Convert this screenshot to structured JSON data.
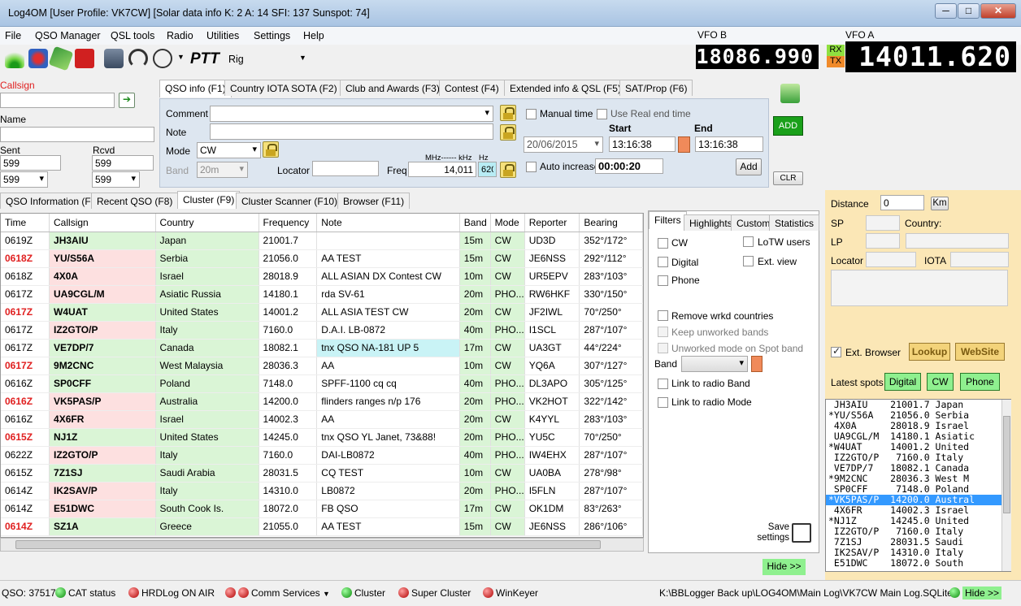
{
  "window": {
    "title": "Log4OM [User Profile: VK7CW] [Solar data info K: 2 A: 14 SFI: 137 Sunspot: 74]"
  },
  "menu": [
    "File",
    "QSO Manager",
    "QSL tools",
    "Radio",
    "Utilities",
    "Settings",
    "Help"
  ],
  "toolbar": {
    "ptt": "PTT",
    "rig_label": "Rig"
  },
  "vfo": {
    "b_label": "VFO B",
    "b_value": "18086.990",
    "a_label": "VFO A",
    "a_value": "14011.620",
    "rx": "RX",
    "tx": "TX"
  },
  "entry": {
    "callsign_label": "Callsign",
    "callsign_value": "",
    "name_label": "Name",
    "name_value": "",
    "sent_label": "Sent",
    "sent_value": "599",
    "sent_select": "599",
    "rcvd_label": "Rcvd",
    "rcvd_value": "599",
    "rcvd_select": "599"
  },
  "qso_tabs": [
    "QSO info (F1)",
    "Country IOTA SOTA (F2)",
    "Club and Awards (F3)",
    "Contest (F4)",
    "Extended info & QSL (F5)",
    "SAT/Prop (F6)"
  ],
  "qso_info": {
    "comment_label": "Comment",
    "note_label": "Note",
    "mode_label": "Mode",
    "mode_value": "CW",
    "band_label": "Band",
    "band_value": "20m",
    "locator_label": "Locator",
    "freq_label": "Freq",
    "freq_units": "MHz------ kHz",
    "hz_label": "Hz",
    "freq_value": "14,011",
    "hz_value": "620",
    "manual_time": "Manual time",
    "use_real_end": "Use Real end time",
    "start_label": "Start",
    "end_label": "End",
    "date": "20/06/2015",
    "start_time": "13:16:38",
    "end_time": "13:16:38",
    "auto_increase": "Auto increase",
    "auto_time": "00:00:20",
    "add": "Add",
    "add_big": "ADD",
    "clr": "CLR"
  },
  "lower_tabs": [
    "QSO Information (F7)",
    "Recent QSO (F8)",
    "Cluster (F9)",
    "Cluster Scanner (F10)",
    "Browser (F11)"
  ],
  "grid": {
    "columns": [
      "Time",
      "Callsign",
      "Country",
      "Frequency",
      "Note",
      "Band",
      "Mode",
      "Reporter",
      "Bearing"
    ],
    "rows": [
      [
        "0619Z",
        "JH3AIU",
        "Japan",
        "21001.7",
        "",
        "15m",
        "CW",
        "UD3D",
        "352°/172°"
      ],
      [
        "0618Z",
        "YU/S56A",
        "Serbia",
        "21056.0",
        "AA TEST",
        "15m",
        "CW",
        "JE6NSS",
        "292°/112°"
      ],
      [
        "0618Z",
        "4X0A",
        "Israel",
        "28018.9",
        "ALL ASIAN DX Contest CW",
        "10m",
        "CW",
        "UR5EPV",
        "283°/103°"
      ],
      [
        "0617Z",
        "UA9CGL/M",
        "Asiatic Russia",
        "14180.1",
        "rda SV-61",
        "20m",
        "PHO...",
        "RW6HKF",
        "330°/150°"
      ],
      [
        "0617Z",
        "W4UAT",
        "United States",
        "14001.2",
        "ALL ASIA TEST CW",
        "20m",
        "CW",
        "JF2IWL",
        "70°/250°"
      ],
      [
        "0617Z",
        "IZ2GTO/P",
        "Italy",
        "7160.0",
        "D.A.I. LB-0872",
        "40m",
        "PHO...",
        "I1SCL",
        "287°/107°"
      ],
      [
        "0617Z",
        "VE7DP/7",
        "Canada",
        "18082.1",
        "tnx QSO NA-181 UP 5",
        "17m",
        "CW",
        "UA3GT",
        "44°/224°"
      ],
      [
        "0617Z",
        "9M2CNC",
        "West Malaysia",
        "28036.3",
        "AA",
        "10m",
        "CW",
        "YQ6A",
        "307°/127°"
      ],
      [
        "0616Z",
        "SP0CFF",
        "Poland",
        "7148.0",
        "SPFF-1100 cq cq",
        "40m",
        "PHO...",
        "DL3APO",
        "305°/125°"
      ],
      [
        "0616Z",
        "VK5PAS/P",
        "Australia",
        "14200.0",
        "flinders ranges n/p 176",
        "20m",
        "PHO...",
        "VK2HOT",
        "322°/142°"
      ],
      [
        "0616Z",
        "4X6FR",
        "Israel",
        "14002.3",
        "AA",
        "20m",
        "CW",
        "K4YYL",
        "283°/103°"
      ],
      [
        "0615Z",
        "NJ1Z",
        "United States",
        "14245.0",
        "tnx QSO YL Janet, 73&88!",
        "20m",
        "PHO...",
        "YU5C",
        "70°/250°"
      ],
      [
        "0622Z",
        "IZ2GTO/P",
        "Italy",
        "7160.0",
        "DAI-LB0872",
        "40m",
        "PHO...",
        "IW4EHX",
        "287°/107°"
      ],
      [
        "0615Z",
        "7Z1SJ",
        "Saudi Arabia",
        "28031.5",
        "CQ TEST",
        "10m",
        "CW",
        "UA0BA",
        "278°/98°"
      ],
      [
        "0614Z",
        "IK2SAV/P",
        "Italy",
        "14310.0",
        "LB0872",
        "20m",
        "PHO...",
        "I5FLN",
        "287°/107°"
      ],
      [
        "0614Z",
        "E51DWC",
        "South Cook Is.",
        "18072.0",
        "FB QSO",
        "17m",
        "CW",
        "OK1DM",
        "83°/263°"
      ],
      [
        "0614Z",
        "SZ1A",
        "Greece",
        "21055.0",
        "AA TEST",
        "15m",
        "CW",
        "JE6NSS",
        "286°/106°"
      ]
    ],
    "red_times": [
      1,
      4,
      7,
      9,
      11,
      16
    ],
    "pink_calls": [
      1,
      2,
      3,
      5,
      9,
      10,
      12,
      14,
      15
    ]
  },
  "filters": {
    "tabs": [
      "Filters",
      "Highlights",
      "Custom",
      "Statistics"
    ],
    "cw": "CW",
    "digital": "Digital",
    "phone": "Phone",
    "lotw": "LoTW users",
    "ext_view": "Ext. view",
    "remove_wrkd": "Remove wrkd countries",
    "keep_unworked": "Keep unworked bands",
    "unworked_mode": "Unworked mode on Spot band",
    "band_label": "Band",
    "link_band": "Link to radio Band",
    "link_mode": "Link to radio Mode",
    "save": "Save settings"
  },
  "hide1": "Hide >>",
  "info": {
    "distance_label": "Distance",
    "distance_value": "0",
    "km": "Km",
    "sp": "SP",
    "lp": "LP",
    "country": "Country:",
    "locator": "Locator",
    "iota": "IOTA",
    "ext_browser": "Ext. Browser",
    "lookup": "Lookup",
    "website": "WebSite",
    "latest_spots": "Latest spots",
    "digital": "Digital",
    "cw": "CW",
    "phone": "Phone"
  },
  "spots": [
    " JH3AIU    21001.7 Japan",
    "*YU/S56A   21056.0 Serbia",
    " 4X0A      28018.9 Israel",
    " UA9CGL/M  14180.1 Asiatic",
    "*W4UAT     14001.2 United",
    " IZ2GTO/P   7160.0 Italy",
    " VE7DP/7   18082.1 Canada",
    "*9M2CNC    28036.3 West M",
    " SP0CFF     7148.0 Poland",
    "*VK5PAS/P  14200.0 Austral",
    " 4X6FR     14002.3 Israel",
    "*NJ1Z      14245.0 United",
    " IZ2GTO/P   7160.0 Italy",
    " 7Z1SJ     28031.5 Saudi",
    " IK2SAV/P  14310.0 Italy",
    " E51DWC    18072.0 South"
  ],
  "status": {
    "qso": "QSO:   37517",
    "cat": "CAT status",
    "hrd": "HRDLog ON AIR",
    "comm": "Comm Services",
    "cluster": "Cluster",
    "supercluster": "Super Cluster",
    "winkeyer": "WinKeyer",
    "path": "K:\\BBLogger Back up\\LOG4OM\\Main Log\\VK7CW Main Log.SQLite",
    "hide": "Hide >>"
  }
}
